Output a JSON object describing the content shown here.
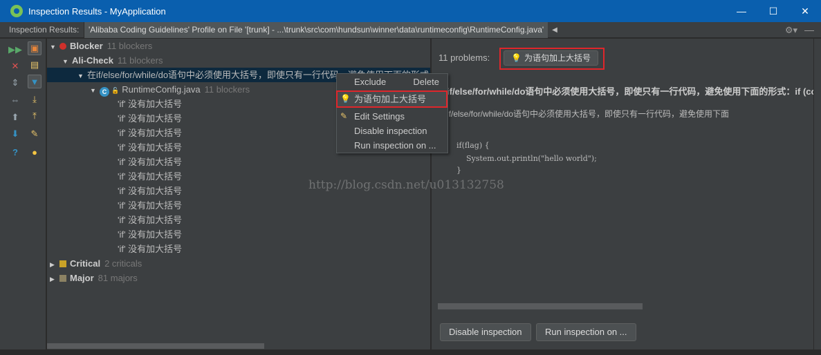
{
  "window": {
    "title": "Inspection Results - MyApplication",
    "minimize": "—",
    "maximize": "☐",
    "close": "✕"
  },
  "header": {
    "label": "Inspection Results:",
    "tab": "'Alibaba Coding Guidelines' Profile on File '[trunk] - ...\\trunk\\src\\com\\hundsun\\winner\\data\\runtimeconfig\\RuntimeConfig.java'",
    "gear": "⚙▾",
    "minus": "—"
  },
  "toolbar": {
    "icons": [
      "rerun-icon",
      "close-icon",
      "expand-all-icon",
      "collapse-all-icon",
      "previous-icon",
      "next-icon",
      "help-icon",
      "group-by-severity-icon",
      "group-by-dir-icon",
      "filter-icon",
      "import-icon",
      "export-icon",
      "edit-settings-icon",
      "quick-fix-icon"
    ]
  },
  "tree": {
    "blocker": {
      "label": "Blocker",
      "count": "11 blockers"
    },
    "alicheck": {
      "label": "Ali-Check",
      "count": "11 blockers"
    },
    "rule": {
      "label": "在if/else/for/while/do语句中必须使用大括号，即使只有一行代码，避免使用下面的形式：if"
    },
    "file": {
      "label": "RuntimeConfig.java",
      "count": "11 blockers"
    },
    "items": [
      "'if' 没有加大括号",
      "'if' 没有加大括号",
      "'if' 没有加大括号",
      "'if' 没有加大括号",
      "'if' 没有加大括号",
      "'if' 没有加大括号",
      "'if' 没有加大括号",
      "'if' 没有加大括号",
      "'if' 没有加大括号",
      "'if' 没有加大括号",
      "'if' 没有加大括号"
    ],
    "critical": {
      "label": "Critical",
      "count": "2 criticals"
    },
    "major": {
      "label": "Major",
      "count": "81 majors"
    }
  },
  "context_menu": {
    "exclude": "Exclude",
    "delete": "Delete",
    "fix": "为语句加上大括号",
    "edit_settings": "Edit Settings",
    "disable": "Disable inspection",
    "run": "Run inspection on ..."
  },
  "detail": {
    "problems": "11 problems:",
    "fix_button": "为语句加上大括号",
    "title": "if/else/for/while/do语句中必须使用大括号，即使只有一行代码，避免使用下面的形式：if (co",
    "body": "if/else/for/while/do语句中必须使用大括号，即使只有一行代码，避免使用下面",
    "code_line1": "if(flag) {",
    "code_line2": "    System.out.println(\"hello world\");",
    "code_line3": "}",
    "watermark": "http://blog.csdn.net/u013132758",
    "disable_button": "Disable inspection",
    "run_button": "Run inspection on ..."
  },
  "colors": {
    "titlebar": "#0a5fae",
    "highlight_box": "#e0262b",
    "critical": "#c9a227",
    "major": "#8c8263",
    "blocker": "#d0302b"
  }
}
